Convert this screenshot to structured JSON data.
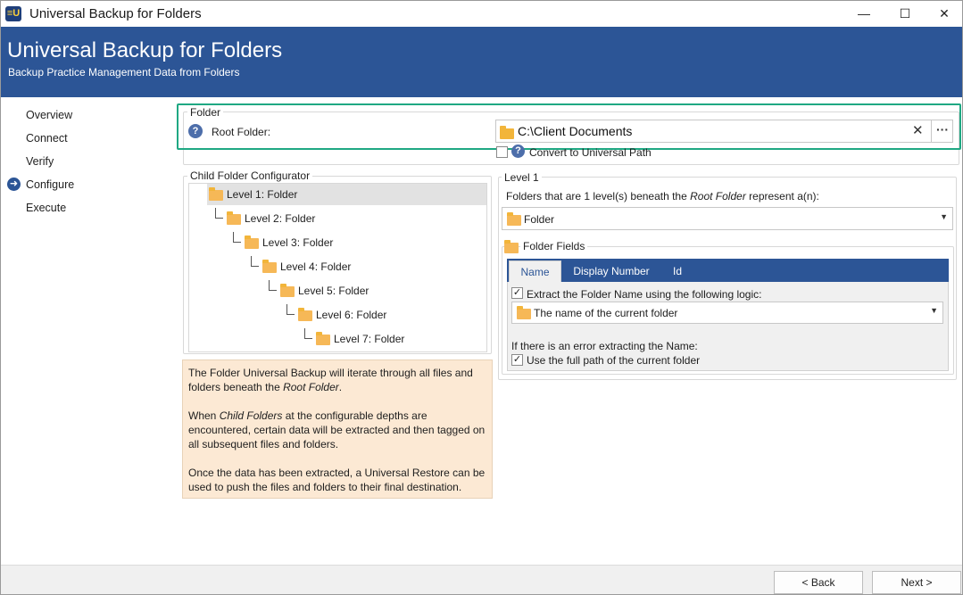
{
  "window": {
    "title": "Universal Backup for Folders",
    "icon_text": "≡U",
    "minimize_glyph": "—",
    "maximize_glyph": "☐",
    "close_glyph": "✕"
  },
  "header": {
    "title": "Universal Backup for Folders",
    "subtitle": "Backup Practice Management Data from Folders"
  },
  "nav": {
    "items": [
      {
        "label": "Overview"
      },
      {
        "label": "Connect"
      },
      {
        "label": "Verify"
      },
      {
        "label": "Configure",
        "active": true
      },
      {
        "label": "Execute"
      }
    ]
  },
  "folder_group": {
    "title": "Folder",
    "root_label": "Root Folder:",
    "root_value": "C:\\Client Documents",
    "clear_glyph": "✕",
    "browse_glyph": "···",
    "convert_label": "Convert to Universal Path",
    "convert_checked": false
  },
  "child_config": {
    "title": "Child Folder Configurator",
    "levels": [
      "Level 1: Folder",
      "Level 2: Folder",
      "Level 3: Folder",
      "Level 4: Folder",
      "Level 5: Folder",
      "Level 6: Folder",
      "Level 7: Folder"
    ],
    "selected_index": 0
  },
  "info": {
    "p1_a": "The Folder Universal Backup will iterate through all files and folders beneath the ",
    "p1_em": "Root Folder",
    "p1_b": ".",
    "p2_a": "When ",
    "p2_em": "Child Folders",
    "p2_b": " at the configurable depths are encountered, certain data will be extracted and then tagged on all subsequent files and folders.",
    "p3": "Once the data has been extracted, a Universal Restore can be used to push the files and folders to their final destination."
  },
  "level_group": {
    "title": "Level 1",
    "desc_a": "Folders that are 1 level(s) beneath the ",
    "desc_em": "Root Folder",
    "desc_b": " represent a(n):",
    "selected": "Folder"
  },
  "folder_fields": {
    "title": "Folder Fields",
    "tabs": [
      "Name",
      "Display Number",
      "Id"
    ],
    "active_tab": 0,
    "extract_label": "Extract the Folder Name using the following logic:",
    "extract_checked": true,
    "logic_selected": "The name of the current folder",
    "error_label": "If there is an error extracting the Name:",
    "fullpath_label": "Use the full path of the current folder",
    "fullpath_checked": true
  },
  "footer": {
    "back_label": "< Back",
    "next_label": "Next >"
  },
  "colors": {
    "brand_blue": "#2c5596",
    "highlight_green": "#1fa883",
    "info_bg": "#fce9d4",
    "folder_yellow": "#f2b53a"
  }
}
